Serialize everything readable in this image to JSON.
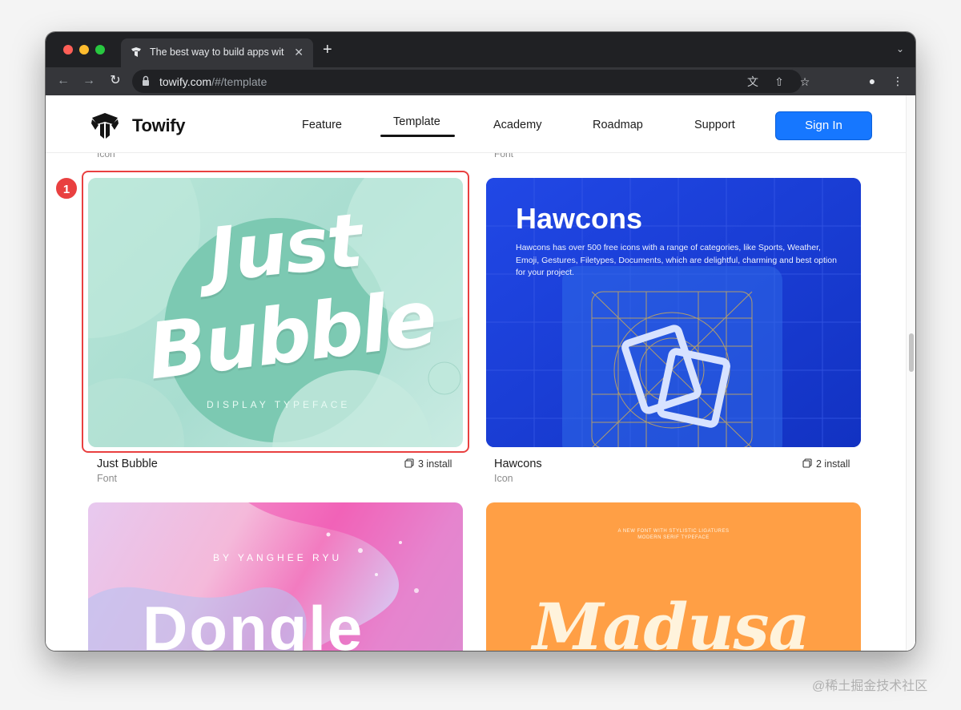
{
  "browser": {
    "tab_title": "The best way to build apps wit",
    "url_host": "towify.com",
    "url_path": "/#/template"
  },
  "header": {
    "logo_text": "Towify",
    "nav": [
      "Feature",
      "Template",
      "Academy",
      "Roadmap",
      "Support"
    ],
    "active_nav": "Template",
    "signin_label": "Sign In"
  },
  "ghost_categories": [
    "Icon",
    "Font"
  ],
  "cards": [
    {
      "title": "Just Bubble",
      "category": "Font",
      "installs": "3 install",
      "art_line1": "Just",
      "art_line2": "Bubble",
      "art_caption": "DISPLAY TYPEFACE"
    },
    {
      "title": "Hawcons",
      "category": "Icon",
      "installs": "2 install",
      "art_heading": "Hawcons",
      "art_text": "Hawcons has over 500 free icons with a range of categories, like Sports, Weather, Emoji, Gestures, Filetypes, Documents, which are delightful, charming and best option for your project."
    },
    {
      "art_byline": "BY YANGHEE RYU",
      "art_word": "Dongle"
    },
    {
      "art_top1": "A NEW FONT WITH STYLISTIC LIGATURES",
      "art_top2": "MODERN SERIF TYPEFACE",
      "art_word": "Madusa"
    }
  ],
  "annotation": {
    "number": "1"
  },
  "watermark": "@稀土掘金技术社区",
  "colors": {
    "accent": "#1677ff",
    "highlight": "#e94040"
  }
}
